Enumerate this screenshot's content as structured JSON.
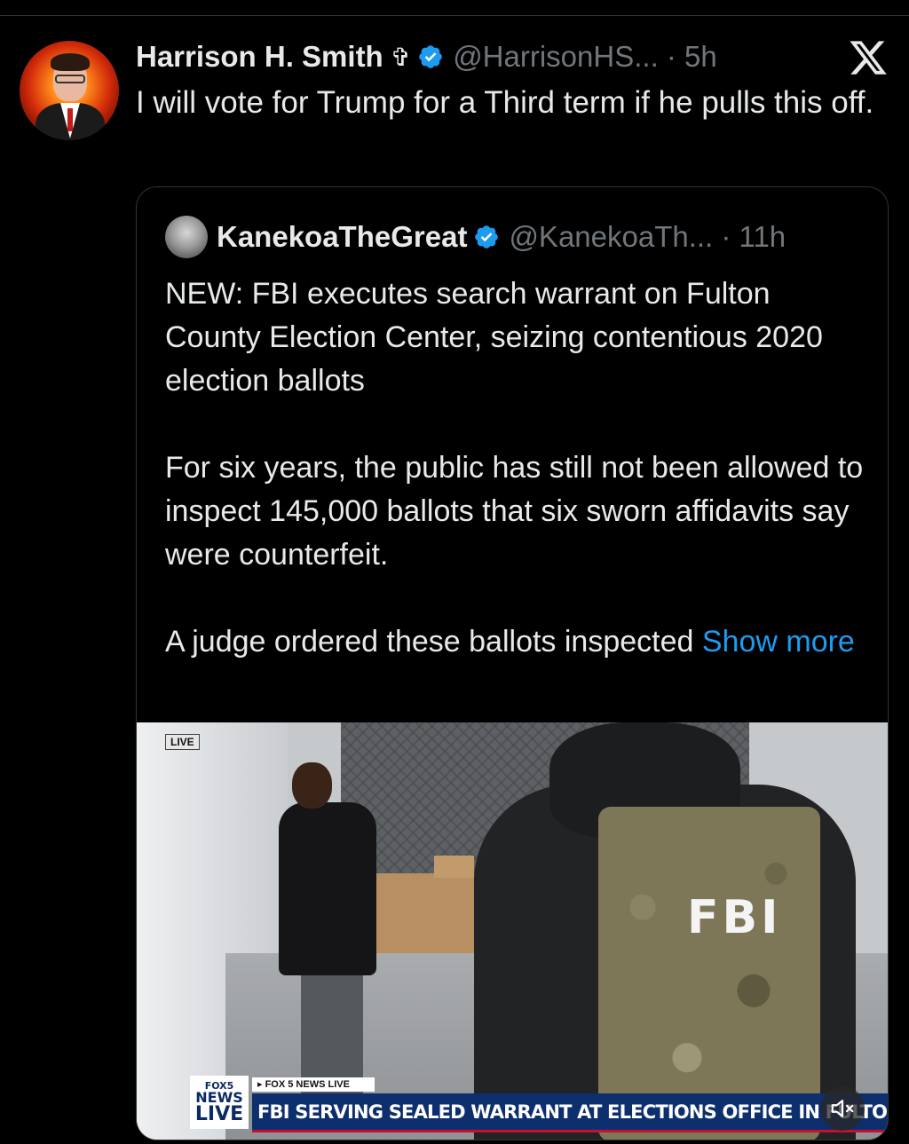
{
  "tweet": {
    "author_name": "Harrison H. Smith",
    "author_symbol": "✞",
    "handle_time": "@HarrisonHS... · 5h",
    "text": "I will vote for Trump for a Third term if he pulls this off."
  },
  "quote": {
    "author_name": "KanekoaTheGreat",
    "handle_time": "@KanekoaTh... · 11h",
    "paragraph1": "NEW: FBI executes search warrant on Fulton County Election Center, seizing contentious 2020 election ballots",
    "paragraph2": "For six years, the public has still not been allowed to inspect 145,000 ballots that six sworn affidavits say were counterfeit.",
    "paragraph3": "A judge ordered these ballots inspected ",
    "show_more": "Show more",
    "media": {
      "live_tag": "LIVE",
      "vest_text": "FBI",
      "logo_line1": "FOX5",
      "logo_line2": "NEWS",
      "logo_line3": "LIVE",
      "subbar": "▸ FOX 5 NEWS LIVE",
      "headline": "FBI SERVING SEALED WARRANT AT ELECTIONS OFFICE IN FULTON COUN"
    }
  },
  "icons": {
    "verified": "verified-badge-icon",
    "x_logo": "x-logo-icon",
    "mute": "speaker-muted-icon"
  },
  "colors": {
    "background": "#000000",
    "text": "#e7e9ea",
    "muted": "#71767b",
    "link": "#1d9bf0",
    "verified": "#1d9bf0",
    "border": "#2f3336"
  }
}
